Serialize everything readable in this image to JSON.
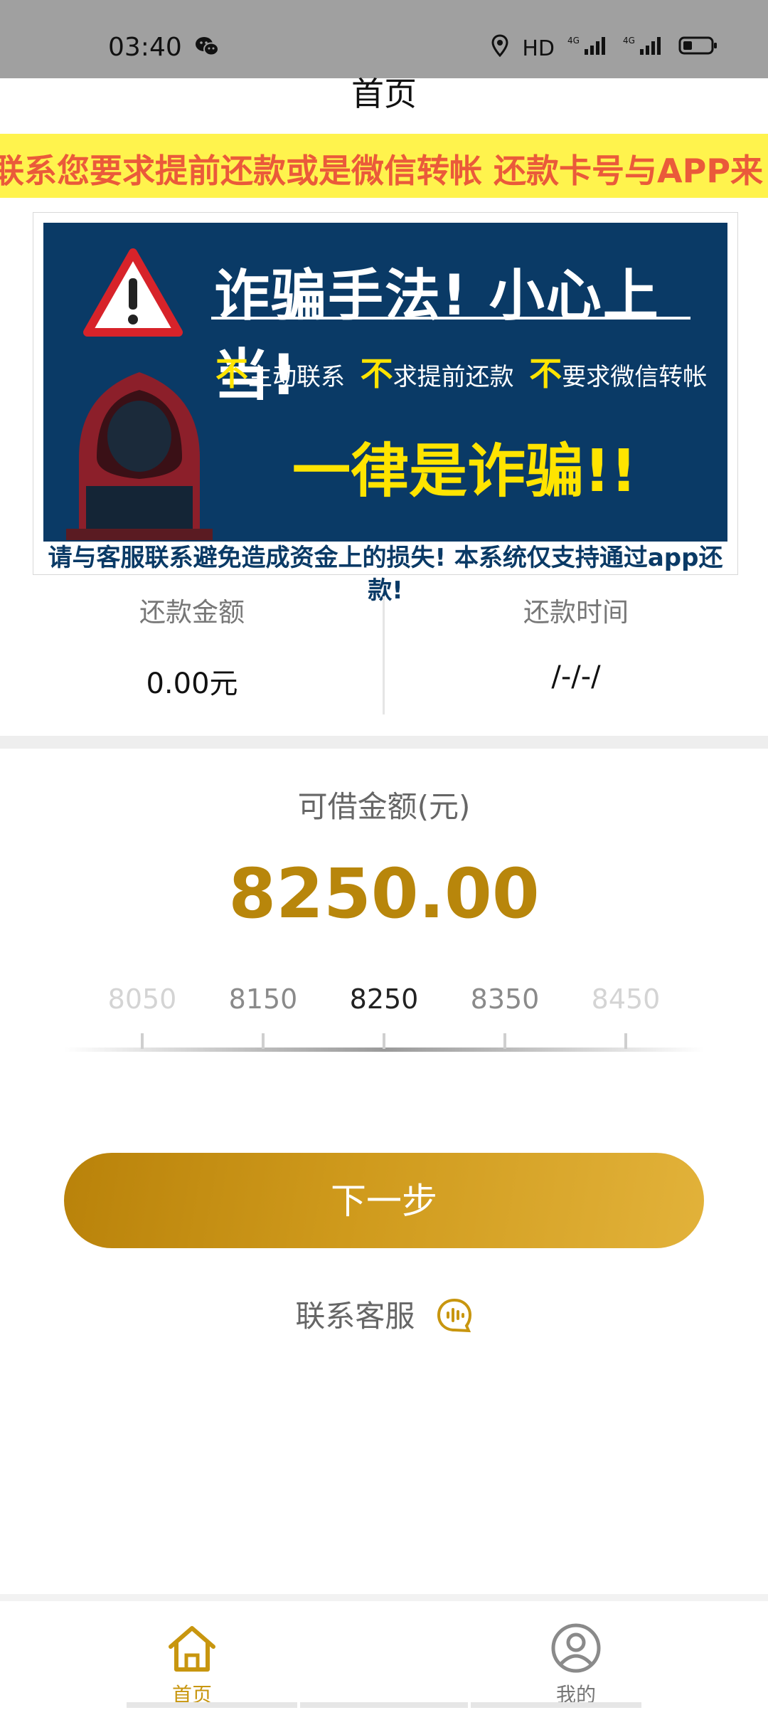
{
  "status_bar": {
    "time": "03:40",
    "network_a": "HD",
    "network_b": "4G",
    "network_c": "4G"
  },
  "header": {
    "title": "首页"
  },
  "notice": {
    "text": "联系您要求提前还款或是微信转帐 还款卡号与APP来"
  },
  "banner": {
    "title": "诈骗手法! 小心上当!",
    "sub1_flag": "不",
    "sub1_text": "主动联系",
    "sub2_flag": "不",
    "sub2_text": "求提前还款",
    "sub3_flag": "不",
    "sub3_text": "要求微信转帐",
    "main": "一律是诈骗!!",
    "footer": "请与客服联系避免造成资金上的损失! 本系统仅支持通过app还款!"
  },
  "repayment": {
    "amount_label": "还款金额",
    "amount_value": "0.00元",
    "time_label": "还款时间",
    "time_value": "/-/-/"
  },
  "loan": {
    "label": "可借金额(元)",
    "amount": "8250.00",
    "scale": [
      "8050",
      "8150",
      "8250",
      "8350",
      "8450"
    ],
    "selected_index": 2,
    "next_button": "下一步",
    "contact": "联系客服"
  },
  "tabbar": {
    "home": "首页",
    "mine": "我的"
  },
  "colors": {
    "accent": "#b8860b",
    "notice_bg": "#fff34d",
    "notice_text": "#ea5a3a",
    "banner_bg": "#0a3a66",
    "banner_highlight": "#ffe400"
  }
}
